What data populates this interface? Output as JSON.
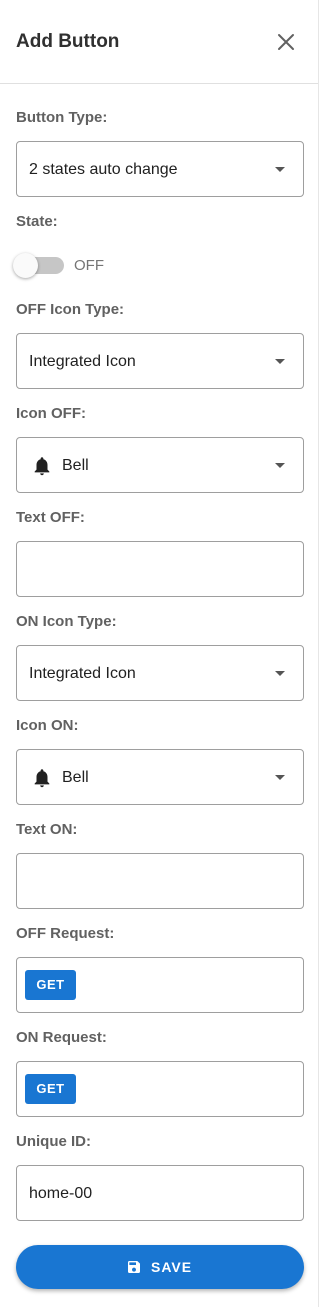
{
  "dialog": {
    "title": "Add Button",
    "close_icon": "close-icon"
  },
  "fields": {
    "button_type": {
      "label": "Button Type:",
      "value": "2 states auto change"
    },
    "state": {
      "label": "State:",
      "value": "OFF",
      "on": false
    },
    "off_icon_type": {
      "label": "OFF Icon Type:",
      "value": "Integrated Icon"
    },
    "icon_off": {
      "label": "Icon OFF:",
      "value": "Bell",
      "icon": "bell-icon"
    },
    "text_off": {
      "label": "Text OFF:",
      "value": ""
    },
    "on_icon_type": {
      "label": "ON Icon Type:",
      "value": "Integrated Icon"
    },
    "icon_on": {
      "label": "Icon ON:",
      "value": "Bell",
      "icon": "bell-icon"
    },
    "text_on": {
      "label": "Text ON:",
      "value": ""
    },
    "off_request": {
      "label": "OFF Request:",
      "method": "GET"
    },
    "on_request": {
      "label": "ON Request:",
      "method": "GET"
    },
    "unique_id": {
      "label": "Unique ID:",
      "value": "home-00"
    }
  },
  "save_button": {
    "label": "SAVE",
    "icon": "save-icon"
  },
  "colors": {
    "primary": "#1976d2",
    "label": "#616161",
    "border": "#9e9e9e"
  }
}
